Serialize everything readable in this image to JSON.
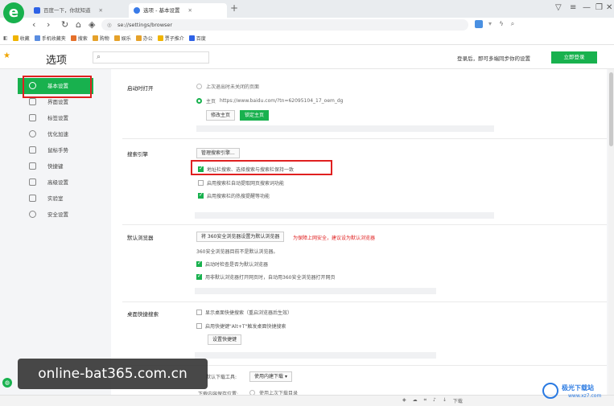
{
  "browser": {
    "logo_glyph": "e",
    "tabs": [
      {
        "label": "百度一下，你就知道",
        "active": false
      },
      {
        "label": "选项 - 基本设置",
        "active": true
      }
    ],
    "new_tab_glyph": "+",
    "address": "se://settings/browser",
    "bookmarks": [
      "收藏",
      "手机收藏夹",
      "搜索",
      "购物",
      "娱乐",
      "办公",
      "贾子推介",
      "百度"
    ]
  },
  "header": {
    "title": "选项",
    "search_placeholder": "",
    "login_hint": "登录后，即可多端同步你的设置",
    "login_button": "立即登录"
  },
  "sidebar": {
    "items": [
      {
        "label": "基本设置",
        "active": true
      },
      {
        "label": "界面设置"
      },
      {
        "label": "标签设置"
      },
      {
        "label": "优化加速"
      },
      {
        "label": "鼠标手势"
      },
      {
        "label": "快捷键"
      },
      {
        "label": "高级设置"
      },
      {
        "label": "实验室"
      },
      {
        "label": "安全设置"
      }
    ]
  },
  "startup": {
    "label": "启动时打开",
    "option_last": "上次退出时未关闭的页面",
    "option_home_label": "主页",
    "option_home_url": "https://www.baidu.com/?tn=62095104_17_oem_dg",
    "modify_home_button": "修改主页",
    "lock_home_button": "锁定主页"
  },
  "search_engine": {
    "label": "搜索引擎",
    "manage_button": "管理搜索引擎...",
    "opt_sync": "地址栏搜索、选择搜索与搜索栏保持一致",
    "opt_related": "启用搜索栏自动提取网页搜索词功能",
    "opt_hot": "启用搜索栏的热搜提醒等功能"
  },
  "default_browser": {
    "label": "默认浏览器",
    "set_button": "将 360安全浏览器设置为默认浏览器",
    "warning": "为保障上网安全，建议设为默认浏览器",
    "status": "360安全浏览器目前不是默认浏览器。",
    "opt_check": "启动时检查是否为默认浏览器",
    "opt_open": "用非默认浏览器打开网页时，自动用360安全浏览器打开网页"
  },
  "desktop_search": {
    "label": "桌面快捷搜索",
    "opt_show": "显示桌面快捷搜索（重启浏览器后生效）",
    "opt_hotkey": "启用快捷键\"Alt+T\"触发桌面快捷搜索",
    "set_hotkey_button": "设置快捷键"
  },
  "download": {
    "tool_label": "默认下载工具:",
    "tool_value": "使用内建下载",
    "location_label": "下载内容保存位置:",
    "location_option": "使用上次下载目录"
  },
  "statusbar": {
    "download": "下载"
  },
  "watermark": "online-bat365.com.cn",
  "brand": {
    "name": "极光下载站",
    "url": "www.xz7.com"
  }
}
